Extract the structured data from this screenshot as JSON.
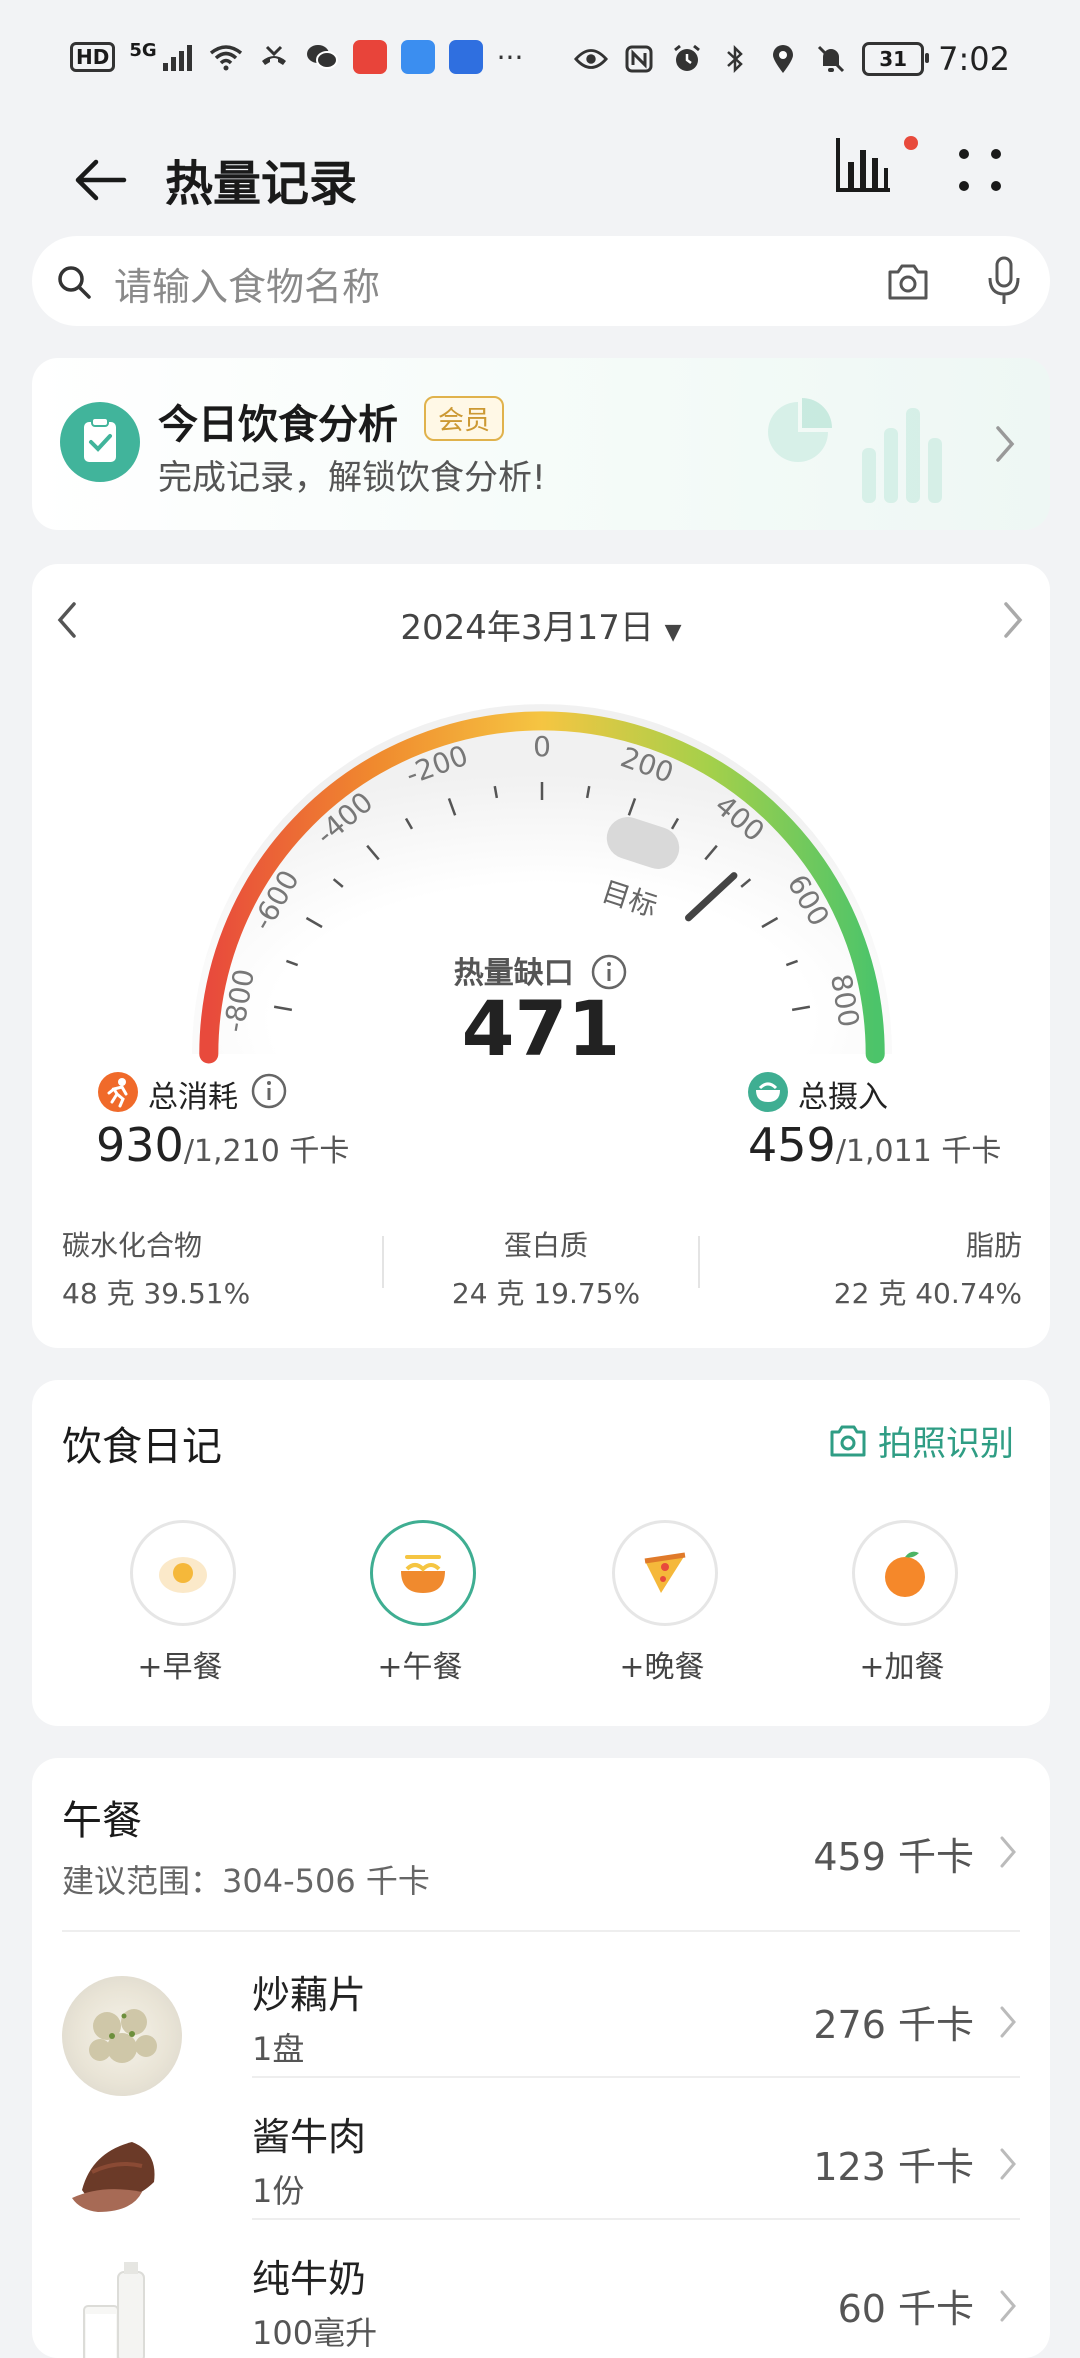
{
  "status_bar": {
    "left_badges": [
      "HD",
      "5G"
    ],
    "more": "···",
    "battery": "31",
    "time": "7:02"
  },
  "header": {
    "title": "热量记录"
  },
  "search": {
    "placeholder": "请输入食物名称"
  },
  "analysis": {
    "title": "今日饮食分析",
    "badge": "会员",
    "subtitle": "完成记录，解锁饮食分析!"
  },
  "calories": {
    "date": "2024年3月17日",
    "gauge_ticks": [
      "-800",
      "-600",
      "-400",
      "-200",
      "0",
      "200",
      "400",
      "600",
      "800"
    ],
    "target_label": "目标",
    "deficit_label": "热量缺口",
    "deficit_value": "471",
    "burn": {
      "label": "总消耗",
      "value": "930",
      "total": "/1,210 千卡"
    },
    "intake": {
      "label": "总摄入",
      "value": "459",
      "total": "/1,011 千卡"
    },
    "macros": [
      {
        "name": "碳水化合物",
        "value": "48 克  39.51%"
      },
      {
        "name": "蛋白质",
        "value": "24 克  19.75%"
      },
      {
        "name": "脂肪",
        "value": "22 克  40.74%"
      }
    ]
  },
  "diary": {
    "title": "饮食日记",
    "photo_label": "拍照识别",
    "meals": [
      {
        "label": "+早餐",
        "icon": "egg-icon"
      },
      {
        "label": "+午餐",
        "icon": "noodle-bowl-icon"
      },
      {
        "label": "+晚餐",
        "icon": "pizza-icon"
      },
      {
        "label": "+加餐",
        "icon": "orange-icon"
      }
    ]
  },
  "lunch": {
    "title": "午餐",
    "range": "建议范围：304-506 千卡",
    "total": "459 千卡",
    "items": [
      {
        "name": "炒藕片",
        "qty": "1盘",
        "kcal": "276 千卡"
      },
      {
        "name": "酱牛肉",
        "qty": "1份",
        "kcal": "123 千卡"
      },
      {
        "name": "纯牛奶",
        "qty": "100毫升",
        "kcal": "60 千卡"
      }
    ]
  },
  "colors": {
    "accent": "#3fae92",
    "burn": "#f06a2a",
    "gauge_low": "#e84a3c",
    "gauge_mid": "#f5c542",
    "gauge_high": "#4cc46a"
  }
}
